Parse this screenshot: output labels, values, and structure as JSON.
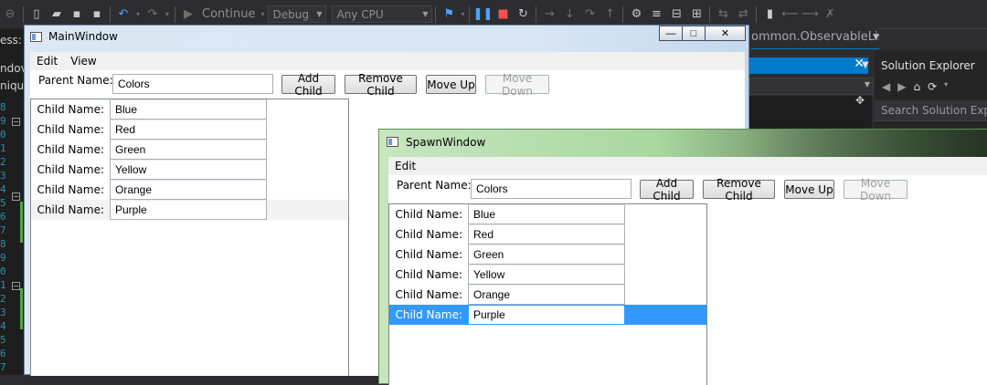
{
  "vs": {
    "toolbar": {
      "continue_label": "Continue",
      "config_value": "Debug",
      "platform_value": "Any CPU"
    },
    "left_labels": [
      "ess:",
      "ndov",
      "niqu"
    ],
    "line_numbers": [
      "8",
      "9",
      "0",
      "1",
      "2",
      "3",
      "4",
      "5",
      "6",
      "7",
      "8",
      "9",
      "0",
      "1",
      "2",
      "3",
      "4",
      "5",
      "6",
      "7"
    ],
    "doc_tab_text": "ommon.ObservableList",
    "solution_explorer": {
      "title": "Solution Explorer",
      "search_placeholder": "Search Solution Explor"
    }
  },
  "main_window": {
    "title": "MainWindow",
    "menu": [
      "Edit",
      "View"
    ],
    "parent_label": "Parent Name:",
    "parent_value": "Colors",
    "buttons": {
      "add_child": "Add Child",
      "remove_child": "Remove Child",
      "move_up": "Move Up",
      "move_down": "Move Down"
    },
    "child_label": "Child Name:",
    "children": [
      "Blue",
      "Red",
      "Green",
      "Yellow",
      "Orange",
      "Purple"
    ],
    "caption_buttons": {
      "minimize": "—",
      "maximize": "□",
      "close": "✕"
    }
  },
  "spawn_window": {
    "title": "SpawnWindow",
    "menu": [
      "Edit"
    ],
    "parent_label": "Parent Name:",
    "parent_value": "Colors",
    "buttons": {
      "add_child": "Add Child",
      "remove_child": "Remove Child",
      "move_up": "Move Up",
      "move_down": "Move Down"
    },
    "child_label": "Child Name:",
    "children": [
      "Blue",
      "Red",
      "Green",
      "Yellow",
      "Orange",
      "Purple"
    ],
    "selected_child": "Purple"
  },
  "colors": {
    "selection": "#3399ff",
    "vs_accent": "#007acc",
    "vs_background": "#2d2d30"
  }
}
